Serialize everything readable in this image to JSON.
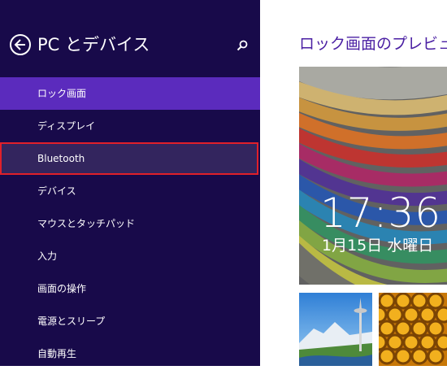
{
  "sidebar": {
    "title": "PC とデバイス",
    "back_icon": "back-arrow-icon",
    "search_icon": "search-icon",
    "bg_color": "#180a4a",
    "selected_color": "#5b2bbd",
    "focus_outline_color": "#e0202a",
    "items": [
      {
        "label": "ロック画面",
        "state": "selected"
      },
      {
        "label": "ディスプレイ",
        "state": "normal"
      },
      {
        "label": "Bluetooth",
        "state": "focused"
      },
      {
        "label": "デバイス",
        "state": "normal"
      },
      {
        "label": "マウスとタッチパッド",
        "state": "normal"
      },
      {
        "label": "入力",
        "state": "normal"
      },
      {
        "label": "画面の操作",
        "state": "normal"
      },
      {
        "label": "電源とスリープ",
        "state": "normal"
      },
      {
        "label": "自動再生",
        "state": "normal"
      }
    ]
  },
  "main": {
    "preview_title": "ロック画面のプレビュー",
    "accent_color": "#4a1fa3",
    "lock_preview": {
      "time": "17:36",
      "date": "1月15日 水曜日"
    },
    "thumbnails": [
      "seattle-skyline-thumbnail",
      "honeycomb-thumbnail"
    ]
  }
}
